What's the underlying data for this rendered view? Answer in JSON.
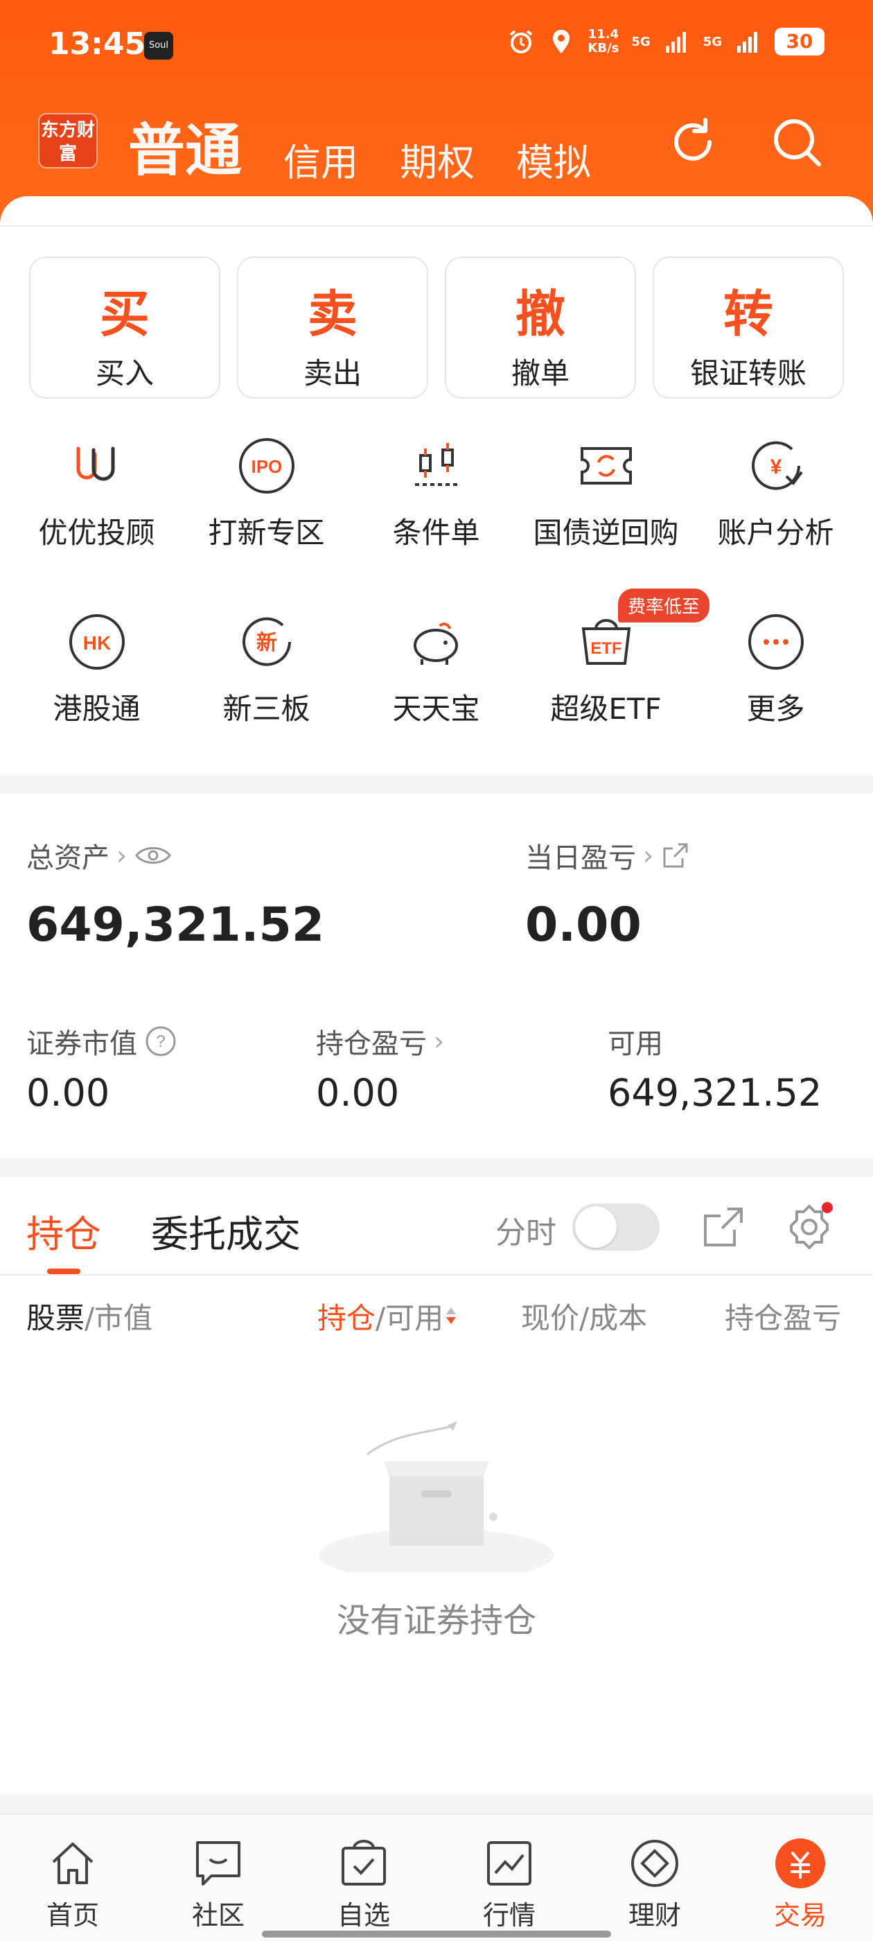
{
  "statusbar": {
    "time": "13:45",
    "soul": "Soul",
    "netspeed_value": "11.4",
    "netspeed_unit": "KB/s",
    "sig1": "5G",
    "sig2": "5G",
    "battery": "30"
  },
  "header": {
    "logo": "东方财富",
    "tabs": [
      {
        "label": "普通"
      },
      {
        "label": "信用"
      },
      {
        "label": "期权"
      },
      {
        "label": "模拟"
      }
    ],
    "icons": [
      "refresh-icon",
      "search-icon"
    ]
  },
  "actions": [
    {
      "big": "买",
      "small": "买入"
    },
    {
      "big": "卖",
      "small": "卖出"
    },
    {
      "big": "撤",
      "small": "撤单"
    },
    {
      "big": "转",
      "small": "银证转账"
    }
  ],
  "grid": [
    {
      "label": "优优投顾",
      "icon": "uu-icon"
    },
    {
      "label": "打新专区",
      "icon": "ipo-icon",
      "icon_text": "IPO"
    },
    {
      "label": "条件单",
      "icon": "condition-icon"
    },
    {
      "label": "国债逆回购",
      "icon": "bond-repo-icon"
    },
    {
      "label": "账户分析",
      "icon": "account-analysis-icon"
    },
    {
      "label": "港股通",
      "icon": "hk-icon",
      "icon_text": "HK"
    },
    {
      "label": "新三板",
      "icon": "neeq-icon",
      "icon_text": "新"
    },
    {
      "label": "天天宝",
      "icon": "piggy-bank-icon"
    },
    {
      "label": "超级ETF",
      "icon": "etf-icon",
      "icon_text": "ETF",
      "badge": "费率低至"
    },
    {
      "label": "更多",
      "icon": "more-icon"
    }
  ],
  "assets": {
    "total_label": "总资产",
    "total_value": "649,321.52",
    "daily_label": "当日盈亏",
    "daily_value": "0.00",
    "market_label": "证券市值",
    "market_value": "0.00",
    "position_pl_label": "持仓盈亏",
    "position_pl_value": "0.00",
    "available_label": "可用",
    "available_value": "649,321.52"
  },
  "holdings": {
    "tab_positions": "持仓",
    "tab_orders": "委托成交",
    "fenshi_label": "分时",
    "columns": {
      "stock": "股票",
      "sep": "/",
      "market_value": "市值",
      "position": "持仓",
      "available": "可用",
      "price_cost": "现价/成本",
      "pl": "持仓盈亏"
    },
    "empty_text": "没有证券持仓"
  },
  "bottom_nav": [
    {
      "label": "首页",
      "icon": "home-icon"
    },
    {
      "label": "社区",
      "icon": "community-icon"
    },
    {
      "label": "自选",
      "icon": "watchlist-icon"
    },
    {
      "label": "行情",
      "icon": "market-icon"
    },
    {
      "label": "理财",
      "icon": "wealth-icon"
    },
    {
      "label": "交易",
      "icon": "trade-icon",
      "active": true
    }
  ],
  "colors": {
    "brand": "#ff5a10",
    "accent": "#f5501e",
    "text": "#222222"
  }
}
